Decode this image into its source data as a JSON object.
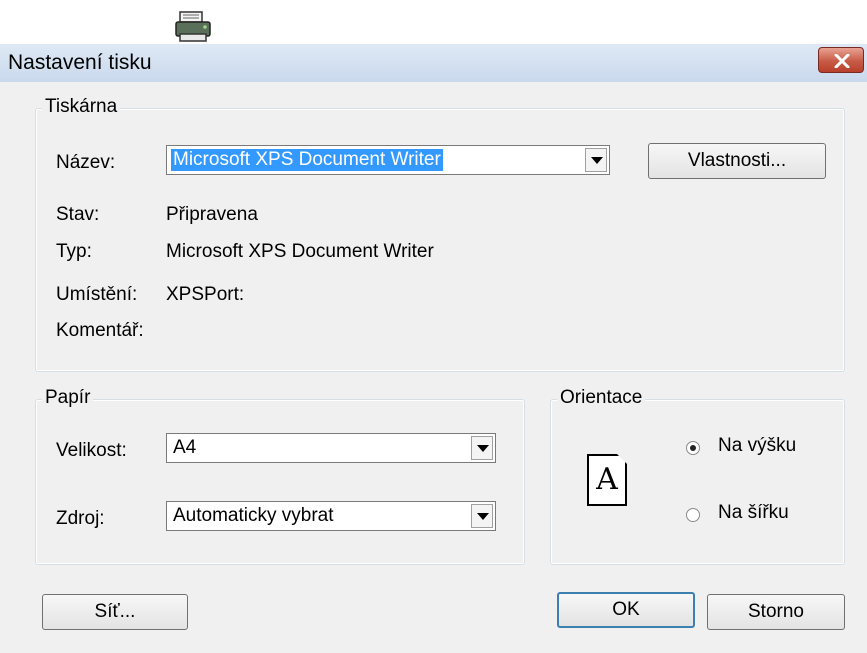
{
  "window": {
    "title": "Nastavení tisku"
  },
  "printer_group": {
    "legend": "Tiskárna",
    "name_label": "Název:",
    "name_value": "Microsoft XPS Document Writer",
    "properties_button": "Vlastnosti...",
    "status_label": "Stav:",
    "status_value": "Připravena",
    "type_label": "Typ:",
    "type_value": "Microsoft XPS Document Writer",
    "location_label": "Umístění:",
    "location_value": "XPSPort:",
    "comment_label": "Komentář:",
    "comment_value": ""
  },
  "paper_group": {
    "legend": "Papír",
    "size_label": "Velikost:",
    "size_value": "A4",
    "source_label": "Zdroj:",
    "source_value": "Automaticky vybrat"
  },
  "orientation_group": {
    "legend": "Orientace",
    "page_glyph": "A",
    "portrait_label": "Na výšku",
    "landscape_label": "Na šířku",
    "selected": "portrait"
  },
  "buttons": {
    "network": "Síť...",
    "ok": "OK",
    "cancel": "Storno"
  },
  "icons": {
    "app": "printer-icon",
    "close": "close-icon"
  },
  "colors": {
    "selection": "#3399ff",
    "close_button": "#c75b46",
    "dialog_bg": "#f0f0f0"
  }
}
